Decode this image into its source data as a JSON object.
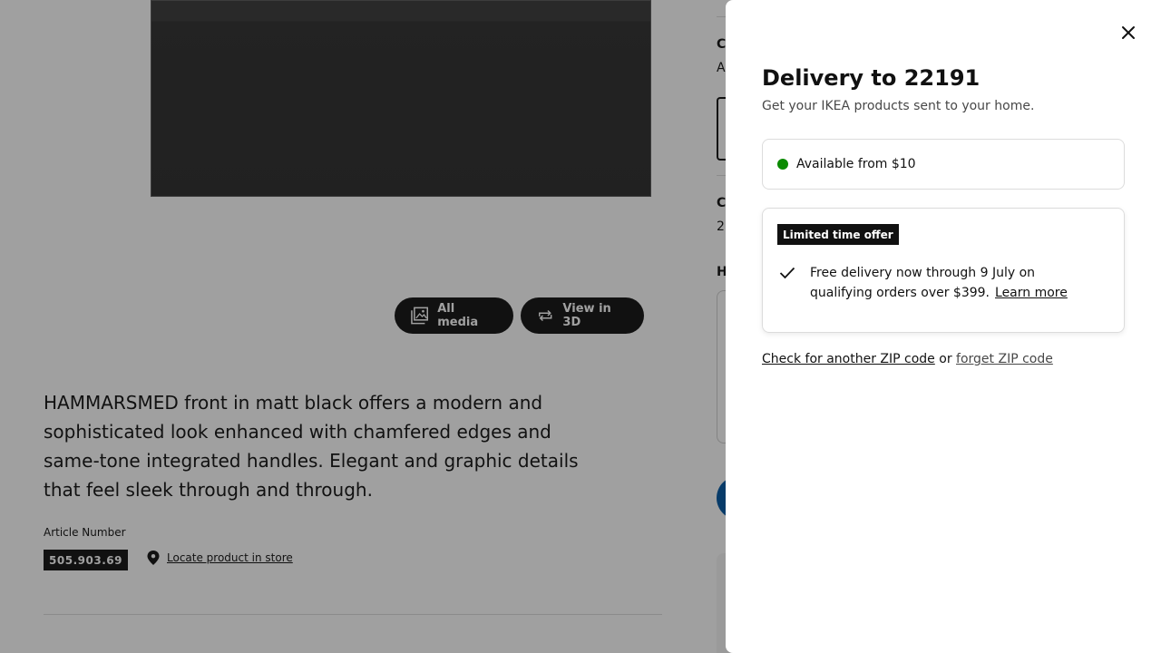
{
  "product": {
    "description": "HAMMARSMED front in matt black offers a modern and sophisticated look enhanced with chamfered edges and same-tone integrated handles. Elegant and graphic details that feel sleek through and through.",
    "article_label": "Article Number",
    "article_number": "505.903.69",
    "locate_link": "Locate product in store",
    "media_buttons": {
      "all_media": "All media",
      "view_3d": "View in 3D"
    }
  },
  "right_column_partial": {
    "heading_1": "C",
    "text_1": "A",
    "heading_2": "C",
    "text_2": "2",
    "heading_3": "H"
  },
  "modal": {
    "title": "Delivery to 22191",
    "subtitle": "Get your IKEA products sent to your home.",
    "availability": {
      "text": "Available from $10",
      "status_color": "#0a8a00"
    },
    "offer": {
      "badge": "Limited time offer",
      "text": "Free delivery now through 9 July on qualifying orders over $399.",
      "link": "Learn more"
    },
    "zip": {
      "check_link": "Check for another ZIP code",
      "or": "or",
      "forget_link": "forget ZIP code"
    }
  },
  "icons": {
    "close": "close-icon",
    "check": "check-icon",
    "media": "image-gallery-icon",
    "rotate": "rotate-3d-icon",
    "pin": "location-pin-icon"
  },
  "colors": {
    "overlay": "#111111",
    "brand_blue": "#0058a3",
    "badge_bg": "#111111"
  }
}
